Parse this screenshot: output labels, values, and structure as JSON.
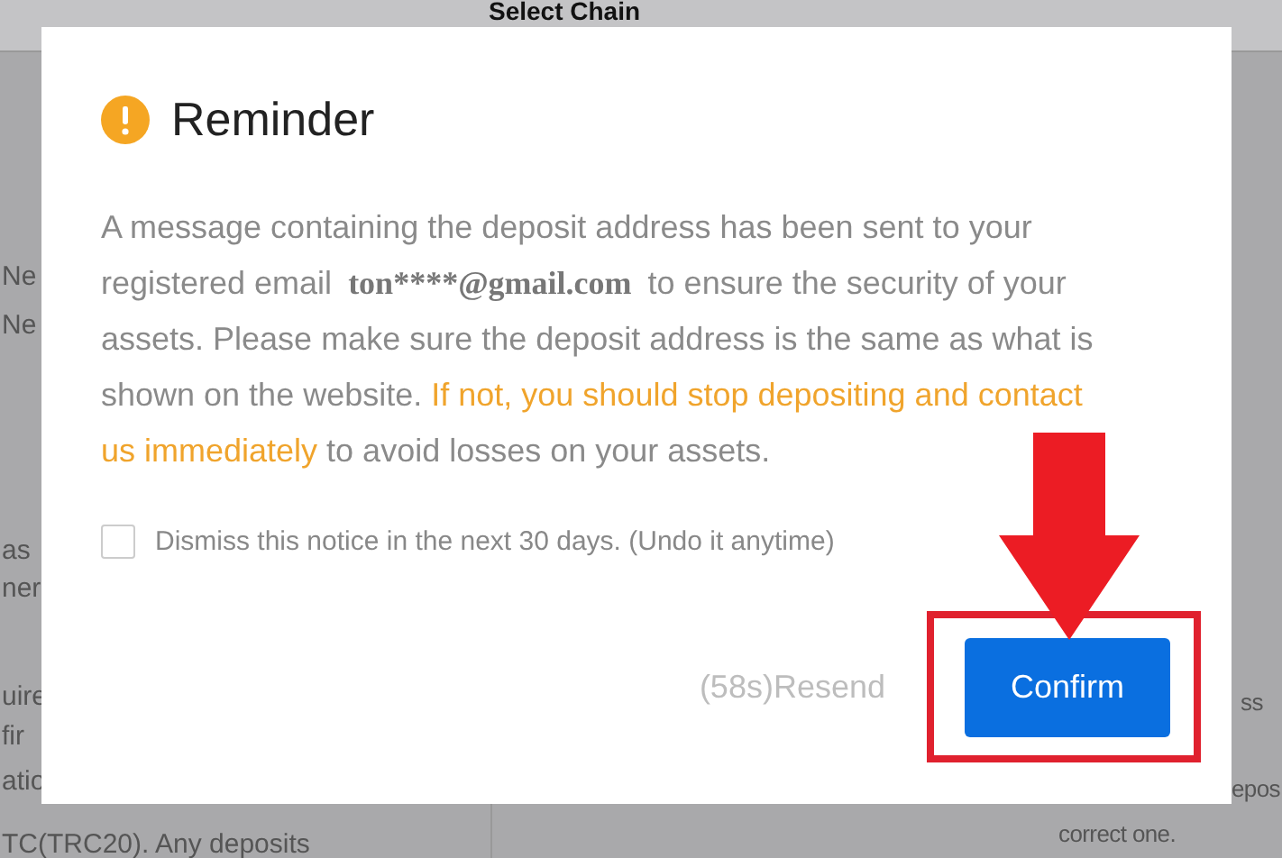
{
  "background": {
    "title": "Select Chain",
    "left_fragments": [
      "Ne",
      "Ne",
      "as",
      "ner",
      "uire",
      "fir",
      "atio",
      "TC(TRC20). Any deposits"
    ],
    "right_fragments": [
      "ss",
      "epos",
      "correct one."
    ]
  },
  "dialog": {
    "title": "Reminder",
    "message": [
      {
        "kind": "plain",
        "text": "A message containing the deposit address has been sent to your registered email "
      },
      {
        "kind": "email",
        "text": "ton****@gmail.com"
      },
      {
        "kind": "plain",
        "text": " to ensure the security of your assets. Please make sure the deposit address is the same as what is shown on the website. "
      },
      {
        "kind": "highlight",
        "text": "If not, you should stop depositing and contact us immediately"
      },
      {
        "kind": "plain",
        "text": " to avoid losses on your assets."
      }
    ],
    "dismiss": {
      "label": "Dismiss this notice in the next 30 days. (Undo it anytime)",
      "checked": false
    },
    "resend": {
      "label": "(58s)Resend",
      "disabled": true
    },
    "confirm": "Confirm"
  }
}
